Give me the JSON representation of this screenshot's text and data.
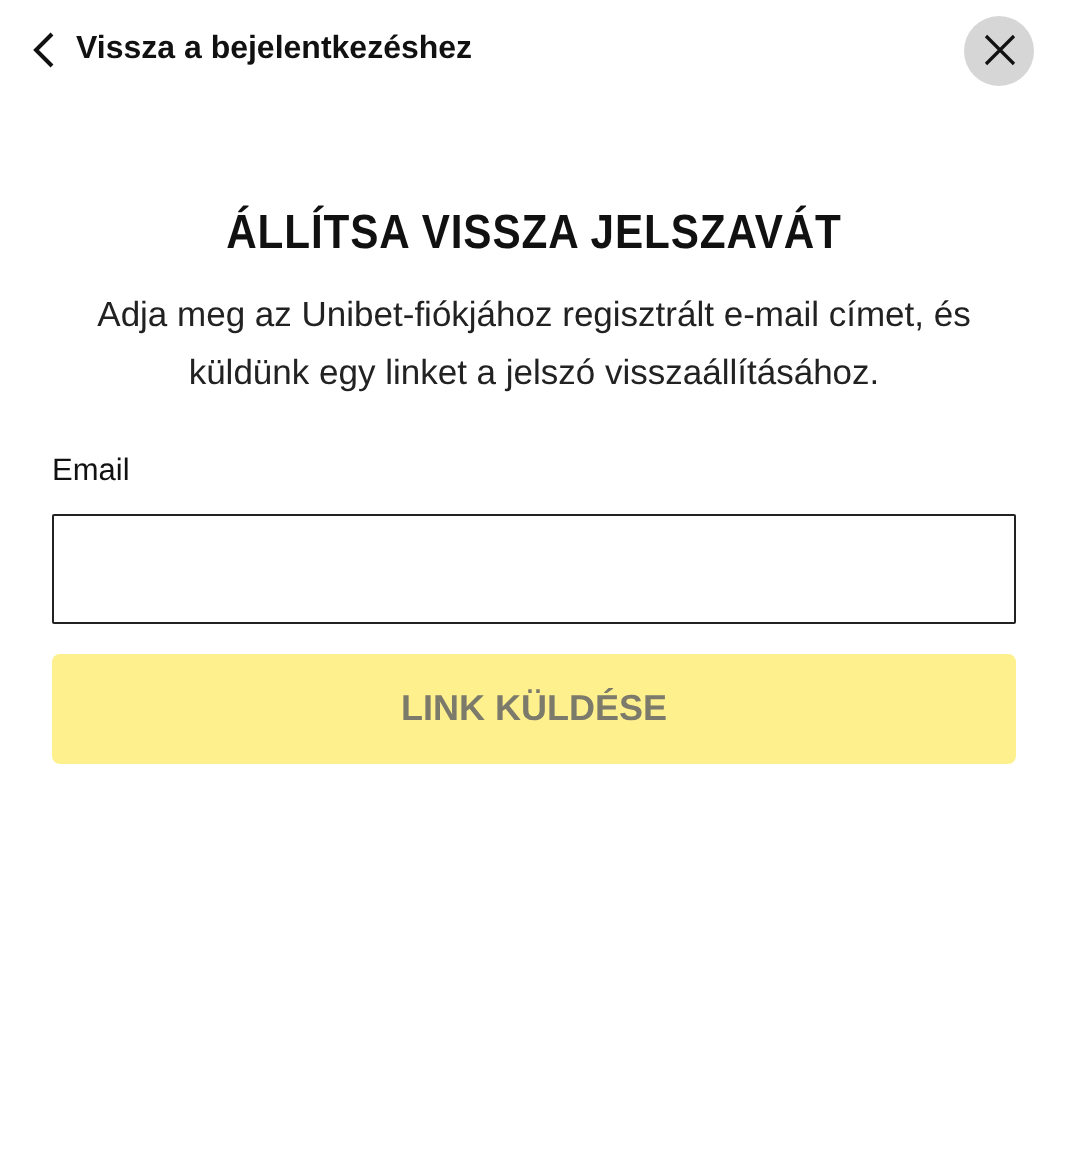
{
  "header": {
    "back_link": "Vissza a bejelentkezéshez"
  },
  "title": "ÁLLÍTSA VISSZA JELSZAVÁT",
  "description": "Adja meg az Unibet-fiókjához regisztrált e-mail címet, és küldünk egy linket a jelszó visszaállításához.",
  "email_field": {
    "label": "Email"
  },
  "submit_button": {
    "label": "LINK KÜLDÉSE",
    "disabled": true
  }
}
